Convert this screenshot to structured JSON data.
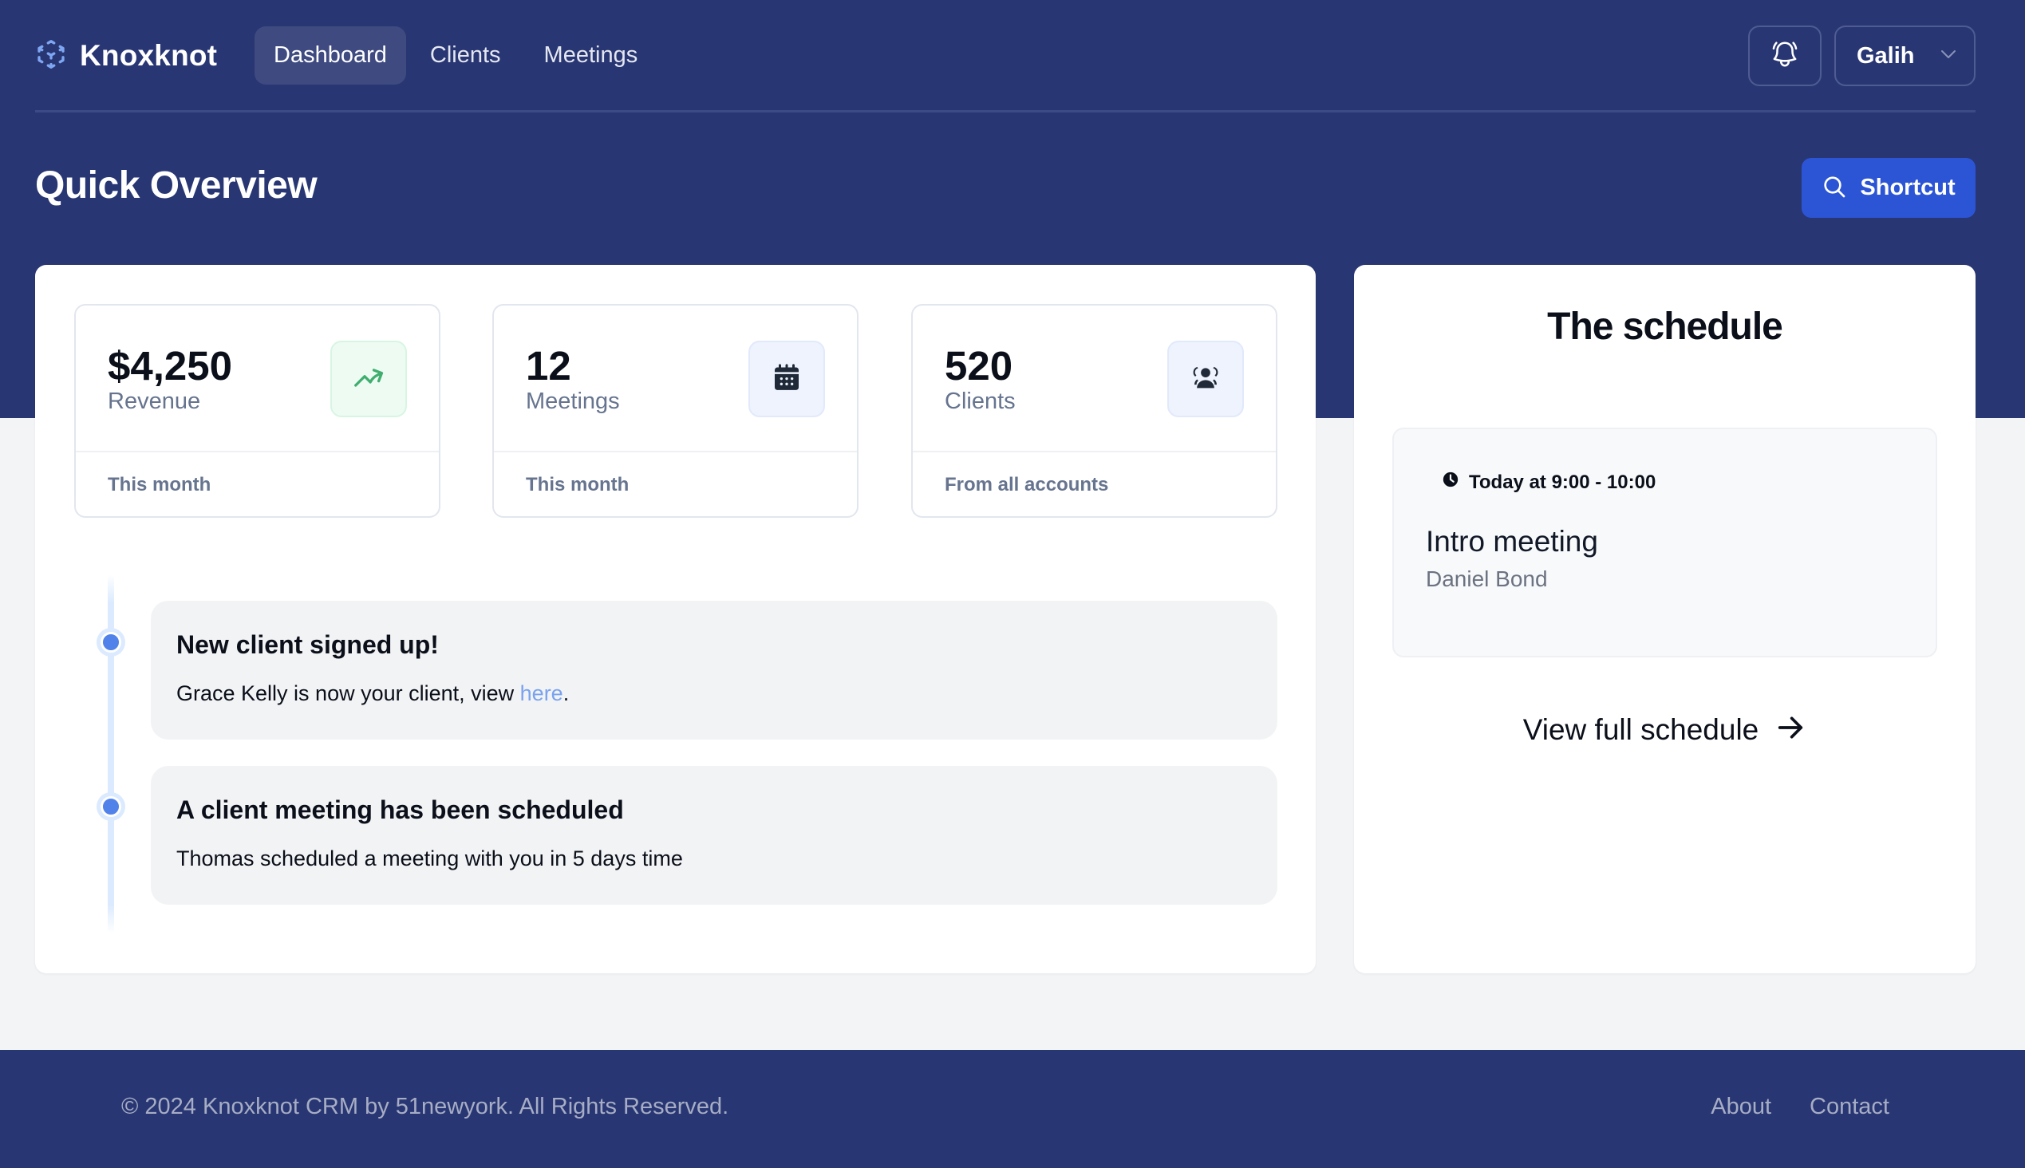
{
  "header": {
    "brand": "Knoxknot",
    "nav": [
      {
        "label": "Dashboard",
        "active": true
      },
      {
        "label": "Clients",
        "active": false
      },
      {
        "label": "Meetings",
        "active": false
      }
    ],
    "notification_icon": "bell-icon",
    "user": {
      "name": "Galih",
      "icon": "chevron-down-icon"
    }
  },
  "page": {
    "title": "Quick Overview",
    "shortcut_label": "Shortcut",
    "shortcut_icon": "search-icon"
  },
  "stats": [
    {
      "value": "$4,250",
      "label": "Revenue",
      "footer": "This month",
      "icon": "trending-up-icon",
      "icon_color": "#3fae6e"
    },
    {
      "value": "12",
      "label": "Meetings",
      "footer": "This month",
      "icon": "calendar-icon",
      "icon_color": "#1f2937"
    },
    {
      "value": "520",
      "label": "Clients",
      "footer": "From all accounts",
      "icon": "users-icon",
      "icon_color": "#1f2937"
    }
  ],
  "timeline": [
    {
      "title": "New client signed up!",
      "text_before": "Grace Kelly is now your client, view ",
      "link": "here",
      "text_after": "."
    },
    {
      "title": "A client meeting has been scheduled",
      "text": "Thomas scheduled a meeting with you in 5 days time"
    }
  ],
  "schedule": {
    "title": "The schedule",
    "item": {
      "time": "Today at 9:00 - 10:00",
      "name": "Intro meeting",
      "person": "Daniel Bond"
    },
    "view_full_label": "View full schedule"
  },
  "footer": {
    "copyright": "© 2024 Knoxknot CRM by 51newyork. All Rights Reserved.",
    "links": [
      "About",
      "Contact"
    ]
  },
  "colors": {
    "brand_dark": "#283673",
    "accent": "#2c55d6",
    "timeline_dot": "#5182ea",
    "link": "#7aa2ee"
  }
}
